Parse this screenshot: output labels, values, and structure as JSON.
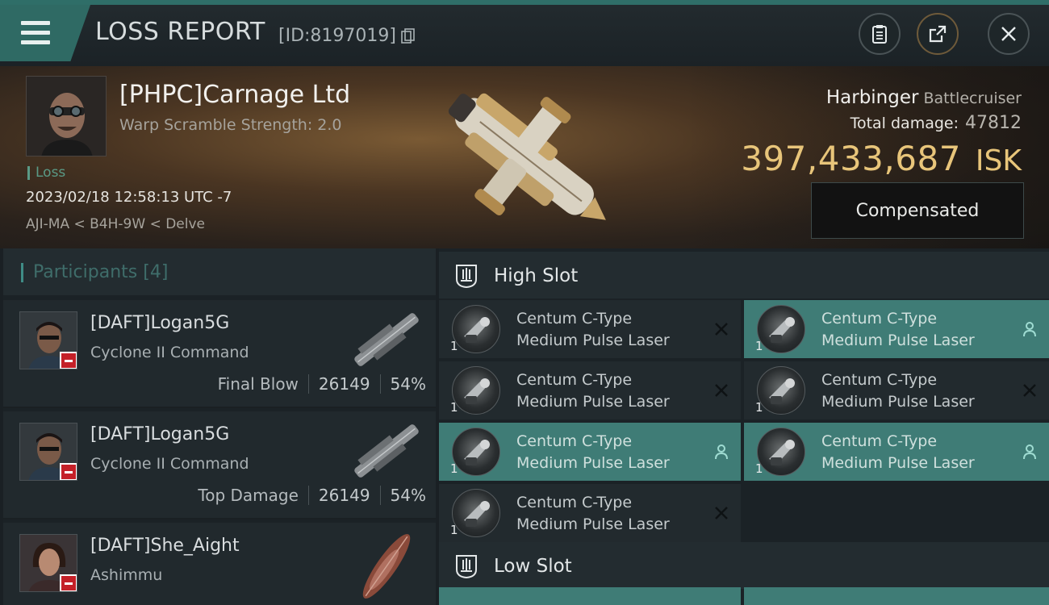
{
  "header": {
    "title": "LOSS REPORT",
    "report_id": "[ID:8197019]"
  },
  "victim": {
    "name": "[PHPC]Carnage Ltd",
    "warp_scramble": "Warp Scramble Strength: 2.0",
    "loss_label": "Loss",
    "timestamp": "2023/02/18 12:58:13 UTC -7",
    "location": "AJI-MA < B4H-9W < Delve"
  },
  "ship": {
    "name": "Harbinger",
    "class": "Battlecruiser",
    "total_damage_label": "Total damage:",
    "total_damage": "47812",
    "isk_value": "397,433,687",
    "isk_unit": "ISK",
    "status_button": "Compensated"
  },
  "participants": {
    "title": "Participants",
    "count": "[4]",
    "rows": [
      {
        "name": "[DAFT]Logan5G",
        "ship": "Cyclone II Command",
        "label": "Final Blow",
        "damage": "26149",
        "percent": "54%"
      },
      {
        "name": "[DAFT]Logan5G",
        "ship": "Cyclone II Command",
        "label": "Top Damage",
        "damage": "26149",
        "percent": "54%"
      },
      {
        "name": "[DAFT]She_Aight",
        "ship": "Ashimmu"
      }
    ]
  },
  "fitting": {
    "high_slot_title": "High Slot",
    "low_slot_title": "Low Slot",
    "high_slot": [
      {
        "line1": "Centum C-Type",
        "line2": "Medium Pulse Laser",
        "qty": "1",
        "status": "destroyed"
      },
      {
        "line1": "Centum C-Type",
        "line2": "Medium Pulse Laser",
        "qty": "1",
        "status": "destroyed"
      },
      {
        "line1": "Centum C-Type",
        "line2": "Medium Pulse Laser",
        "qty": "1",
        "status": "dropped"
      },
      {
        "line1": "Centum C-Type",
        "line2": "Medium Pulse Laser",
        "qty": "1",
        "status": "destroyed"
      },
      {
        "line1": "Centum C-Type",
        "line2": "Medium Pulse Laser",
        "qty": "1",
        "status": "dropped"
      },
      {
        "line1": "Centum C-Type",
        "line2": "Medium Pulse Laser",
        "qty": "1",
        "status": "destroyed"
      },
      {
        "line1": "Centum C-Type",
        "line2": "Medium Pulse Laser",
        "qty": "1",
        "status": "dropped"
      }
    ]
  },
  "colors": {
    "accent_teal": "#3f7c76",
    "isk_gold": "#e8c57a",
    "loss_green": "#5a9a86",
    "kill_red": "#c42028"
  }
}
